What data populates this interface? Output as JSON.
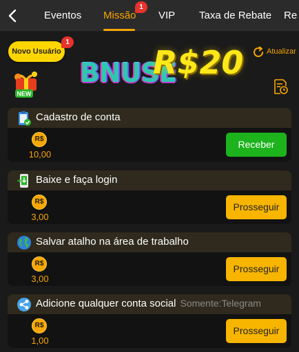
{
  "nav": {
    "tabs": [
      {
        "label": "Eventos"
      },
      {
        "label": "Missão",
        "badge": "1",
        "active": true
      },
      {
        "label": "VIP"
      },
      {
        "label": "Taxa de Rebate"
      },
      {
        "label": "Re"
      }
    ]
  },
  "header": {
    "new_user_label": "Novo Usuário",
    "new_user_badge": "1",
    "gift_tag": "NEW",
    "promo_word": "BNUSE",
    "promo_amount": "R$20",
    "refresh_label": "Atualizar"
  },
  "tasks": [
    {
      "title": "Cadastro de conta",
      "note": "",
      "currency": "R$",
      "reward": "10,00",
      "button": "Receber",
      "button_state": "claim",
      "icon": "clipboard-check-icon"
    },
    {
      "title": "Baixe e faça login",
      "note": "",
      "currency": "R$",
      "reward": "3,00",
      "button": "Prosseguir",
      "button_state": "go",
      "icon": "phone-download-icon"
    },
    {
      "title": "Salvar atalho na área de trabalho",
      "note": "",
      "currency": "R$",
      "reward": "3,00",
      "button": "Prosseguir",
      "button_state": "go",
      "icon": "globe-icon"
    },
    {
      "title": "Adicione qualquer conta social",
      "note": "Somente:Telegram",
      "currency": "R$",
      "reward": "1,00",
      "button": "Prosseguir",
      "button_state": "go",
      "icon": "social-share-icon"
    }
  ],
  "colors": {
    "accent": "#f7a600",
    "claim_green": "#1db31d",
    "badge_red": "#e7322d",
    "promo_yellow": "#ffe81a"
  }
}
